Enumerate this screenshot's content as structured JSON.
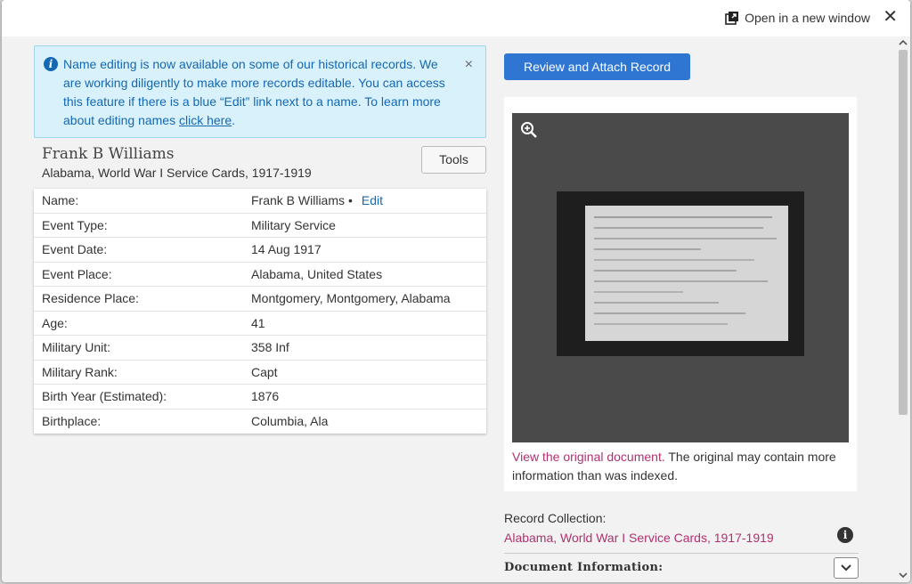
{
  "header": {
    "open_new_window": "Open in a new window",
    "close_symbol": "✕"
  },
  "banner": {
    "text": "Name editing is now available on some of our historical records. We are working diligently to make more records editable. You can access this feature if there is a blue “Edit” link next to a name. To learn more about editing names ",
    "link": "click here",
    "end": ".",
    "close_symbol": "×",
    "icon": "info-icon"
  },
  "record": {
    "name": "Frank B Williams",
    "collection": "Alabama, World War I Service Cards, 1917-1919",
    "tools_label": "Tools"
  },
  "fields": [
    {
      "label": "Name:",
      "value": "Frank B Williams",
      "bullet": "•",
      "edit": "Edit"
    },
    {
      "label": "Event Type:",
      "value": "Military Service"
    },
    {
      "label": "Event Date:",
      "value": "14 Aug 1917"
    },
    {
      "label": "Event Place:",
      "value": "Alabama, United States"
    },
    {
      "label": "Residence Place:",
      "value": "Montgomery, Montgomery, Alabama"
    },
    {
      "label": "Age:",
      "value": "41"
    },
    {
      "label": "Military Unit:",
      "value": "358 Inf"
    },
    {
      "label": "Military Rank:",
      "value": "Capt"
    },
    {
      "label": "Birth Year (Estimated):",
      "value": "1876"
    },
    {
      "label": "Birthplace:",
      "value": "Columbia, Ala"
    }
  ],
  "actions": {
    "attach_label": "Review and Attach Record"
  },
  "image_panel": {
    "view_original_link": "View the original document.",
    "caption_rest": " The original may contain more information than was indexed."
  },
  "collection_section": {
    "label": "Record Collection:",
    "link": "Alabama, World War I Service Cards, 1917-1919",
    "info_symbol": "i"
  },
  "document_info": {
    "label": "Document Information:"
  },
  "colors": {
    "accent_blue": "#2f76d3",
    "link_magenta": "#b0316f",
    "banner_bg": "#d9f1fb"
  }
}
